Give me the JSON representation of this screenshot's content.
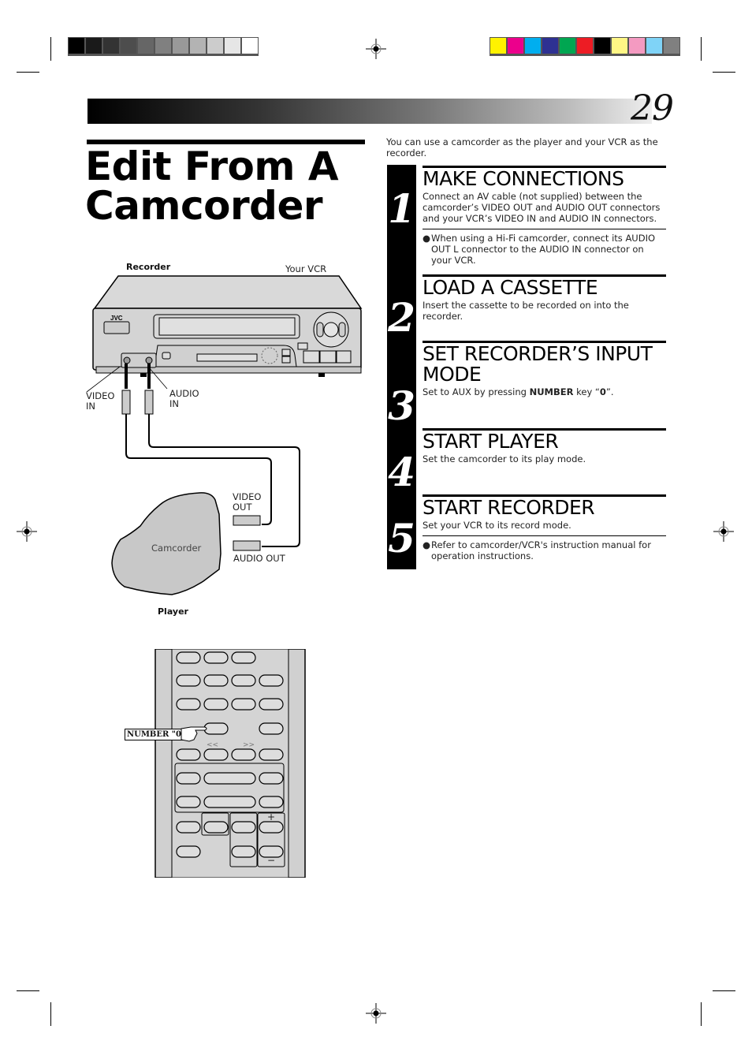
{
  "print_marks": {
    "gray_swatches": [
      "#000000",
      "#1a1a1a",
      "#333333",
      "#4d4d4d",
      "#666666",
      "#808080",
      "#999999",
      "#b3b3b3",
      "#cccccc",
      "#e6e6e6",
      "#ffffff"
    ],
    "color_swatches": [
      "#fff200",
      "#ec008c",
      "#00aeef",
      "#2e3192",
      "#00a651",
      "#ed1c24",
      "#000000",
      "#fff685",
      "#f49ac1",
      "#7fd3f7",
      "#808080"
    ]
  },
  "header": {
    "page_number": "29"
  },
  "title": {
    "line1": "Edit From A",
    "line2": "Camcorder"
  },
  "intro": "You can use a camcorder as the player and your VCR as the recorder.",
  "steps": [
    {
      "number": "1",
      "heading": "MAKE CONNECTIONS",
      "body": "Connect an AV cable (not supplied) between the camcorder’s VIDEO OUT and AUDIO OUT connectors and your VCR’s VIDEO IN and AUDIO IN connectors.",
      "bullet": "When using a Hi-Fi camcorder, connect its AUDIO OUT L connector to the AUDIO IN connector on your VCR."
    },
    {
      "number": "2",
      "heading": "LOAD A CASSETTE",
      "body": "Insert the cassette to be recorded on into the recorder."
    },
    {
      "number": "3",
      "heading": "SET RECORDER’S INPUT MODE",
      "body_prefix": "Set to AUX by pressing ",
      "body_bold": "NUMBER",
      "body_mid": " key “",
      "body_key": "0",
      "body_suffix": "”."
    },
    {
      "number": "4",
      "heading": "START PLAYER",
      "body": "Set the camcorder to its play mode."
    },
    {
      "number": "5",
      "heading": "START RECORDER",
      "body": "Set your VCR to its record mode.",
      "bullet": "Refer to camcorder/VCR's instruction manual for operation instructions."
    }
  ],
  "diagram": {
    "recorder_label": "Recorder",
    "vcr_label": "Your VCR",
    "brand": "JVC",
    "video_in_label_1": "VIDEO",
    "video_in_label_2": "IN",
    "audio_in_label_1": "AUDIO",
    "audio_in_label_2": "IN",
    "video_out_label_1": "VIDEO",
    "video_out_label_2": "OUT",
    "audio_out_label": "AUDIO OUT",
    "camcorder_label": "Camcorder",
    "player_label": "Player"
  },
  "remote": {
    "callout": "NUMBER \"0\"",
    "rew_symbol": "<<",
    "ff_symbol": ">>",
    "plus": "+",
    "minus": "−"
  }
}
